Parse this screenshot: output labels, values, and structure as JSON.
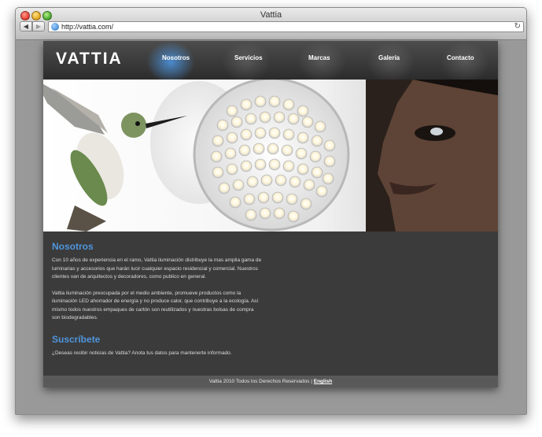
{
  "window": {
    "title": "Vattia",
    "url": "http://vattia.com/"
  },
  "site": {
    "logo": "VATTIA",
    "nav": [
      {
        "label": "Nosotros"
      },
      {
        "label": "Servicios"
      },
      {
        "label": "Marcas"
      },
      {
        "label": "Galería"
      },
      {
        "label": "Contacto"
      }
    ],
    "sections": {
      "nosotros": {
        "title": "Nosotros",
        "p1": "Con 10 años de experiencia en el ramo, Vattia iluminación distribuye la mas amplia gama de luminarias y accesorios que harán lucir cualquier espacio residencial y comercial. Nuestros clientes van de arquitectos y decoradores, como publico en general.",
        "p2": "Vattia iluminación preocupada por el medio ambiente, promueve productos como la iluminación LED ahorrador de energía y no produce calor, que contribuye a la ecología. Así mismo todos nuestros empaques de cartón son reutilizados y nuestras bolsas de compra son biodegradables."
      },
      "suscribete": {
        "title": "Suscríbete",
        "text": "¿Deseas recibir noticias de Vattia? Anota tus datos para mantenerte informado."
      }
    },
    "footer": {
      "text": "Vattia 2010 Todos los Derechos Reservados |",
      "language": "English"
    }
  },
  "colors": {
    "accent": "#4f95dc",
    "page_bg": "#3b3b3b",
    "header_bg": "#2c2c2c"
  }
}
